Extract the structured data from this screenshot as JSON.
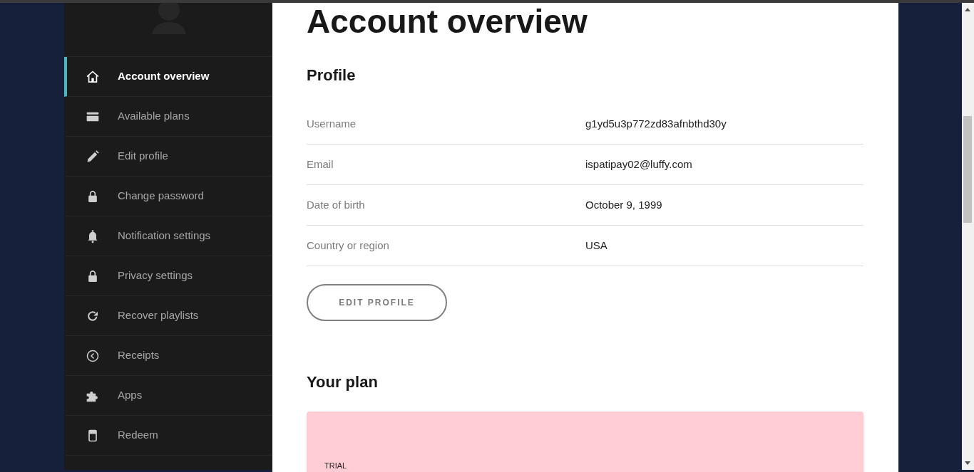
{
  "page": {
    "title": "Account overview"
  },
  "sidebar": {
    "items": [
      {
        "label": "Account overview",
        "selected": true
      },
      {
        "label": "Available plans",
        "selected": false
      },
      {
        "label": "Edit profile",
        "selected": false
      },
      {
        "label": "Change password",
        "selected": false
      },
      {
        "label": "Notification settings",
        "selected": false
      },
      {
        "label": "Privacy settings",
        "selected": false
      },
      {
        "label": "Recover playlists",
        "selected": false
      },
      {
        "label": "Receipts",
        "selected": false
      },
      {
        "label": "Apps",
        "selected": false
      },
      {
        "label": "Redeem",
        "selected": false
      }
    ]
  },
  "profile": {
    "heading": "Profile",
    "rows": [
      {
        "label": "Username",
        "value": "g1yd5u3p772zd83afnbthd30y"
      },
      {
        "label": "Email",
        "value": "ispatipay02@luffy.com"
      },
      {
        "label": "Date of birth",
        "value": "October 9, 1999"
      },
      {
        "label": "Country or region",
        "value": "USA"
      }
    ],
    "button": "EDIT PROFILE"
  },
  "plan": {
    "heading": "Your plan",
    "card": {
      "label": "TRIAL"
    }
  }
}
